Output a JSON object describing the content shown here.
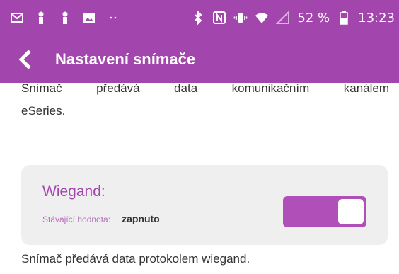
{
  "status_bar": {
    "battery_percent": "52 %",
    "time": "13:23",
    "icons": [
      "gmail-icon",
      "person-icon",
      "person-icon",
      "image-icon",
      "more-dots-icon",
      "bluetooth-icon",
      "nfc-icon",
      "vibrate-icon",
      "wifi-icon",
      "no-signal-icon",
      "battery-icon"
    ]
  },
  "app_bar": {
    "title": "Nastavení snímače"
  },
  "eseries": {
    "description_line1": "Snímač předává data komunikačním kanálem",
    "description_line2": "eSeries."
  },
  "wiegand": {
    "title": "Wiegand:",
    "current_label": "Stávající hodnota:",
    "current_value": "zapnuto",
    "toggle_on": true,
    "description": "Snímač předává data protokolem wiegand."
  },
  "colors": {
    "accent": "#a245ac",
    "toggle_on": "#b04fb8",
    "card_bg": "#efefef"
  }
}
